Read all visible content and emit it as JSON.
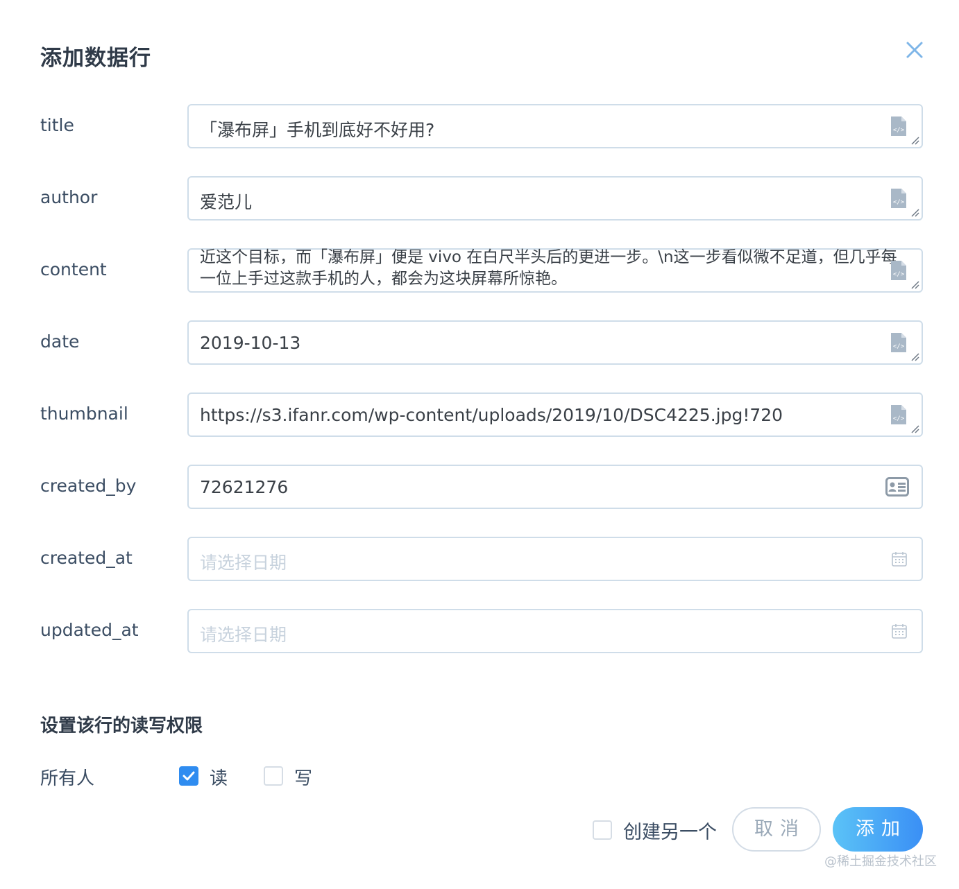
{
  "dialog": {
    "title": "添加数据行",
    "close_icon": "close-icon"
  },
  "fields": [
    {
      "key": "title",
      "label": "title",
      "value": "「瀑布屏」手机到底好不好用?",
      "icon": "code-file-icon"
    },
    {
      "key": "author",
      "label": "author",
      "value": "爱范儿",
      "icon": "code-file-icon"
    },
    {
      "key": "content",
      "label": "content",
      "value": "近这个目标，而「瀑布屏」便是 vivo 在白尺半头后的更进一步。\\n这一步看似微不足道，但几乎每一位上手过这款手机的人，都会为这块屏幕所惊艳。",
      "icon": "code-file-icon"
    },
    {
      "key": "date",
      "label": "date",
      "value": "2019-10-13",
      "icon": "code-file-icon"
    },
    {
      "key": "thumbnail",
      "label": "thumbnail",
      "value": "https://s3.ifanr.com/wp-content/uploads/2019/10/DSC4225.jpg!720",
      "icon": "code-file-icon"
    },
    {
      "key": "created_by",
      "label": "created_by",
      "value": "72621276",
      "icon": "id-card-icon"
    },
    {
      "key": "created_at",
      "label": "created_at",
      "placeholder": "请选择日期",
      "icon": "calendar-icon"
    },
    {
      "key": "updated_at",
      "label": "updated_at",
      "placeholder": "请选择日期",
      "icon": "calendar-icon"
    }
  ],
  "permissions": {
    "title": "设置该行的读写权限",
    "who": "所有人",
    "read_label": "读",
    "read_checked": true,
    "write_label": "写",
    "write_checked": false
  },
  "footer": {
    "create_another_label": "创建另一个",
    "create_another_checked": false,
    "cancel_label": "取消",
    "add_label": "添加"
  },
  "watermark": "@稀土掘金技术社区",
  "colors": {
    "accent": "#2f8cf0",
    "border": "#cfdde9",
    "add_gradient_start": "#5bc3f7",
    "add_gradient_end": "#3a8ff5"
  }
}
